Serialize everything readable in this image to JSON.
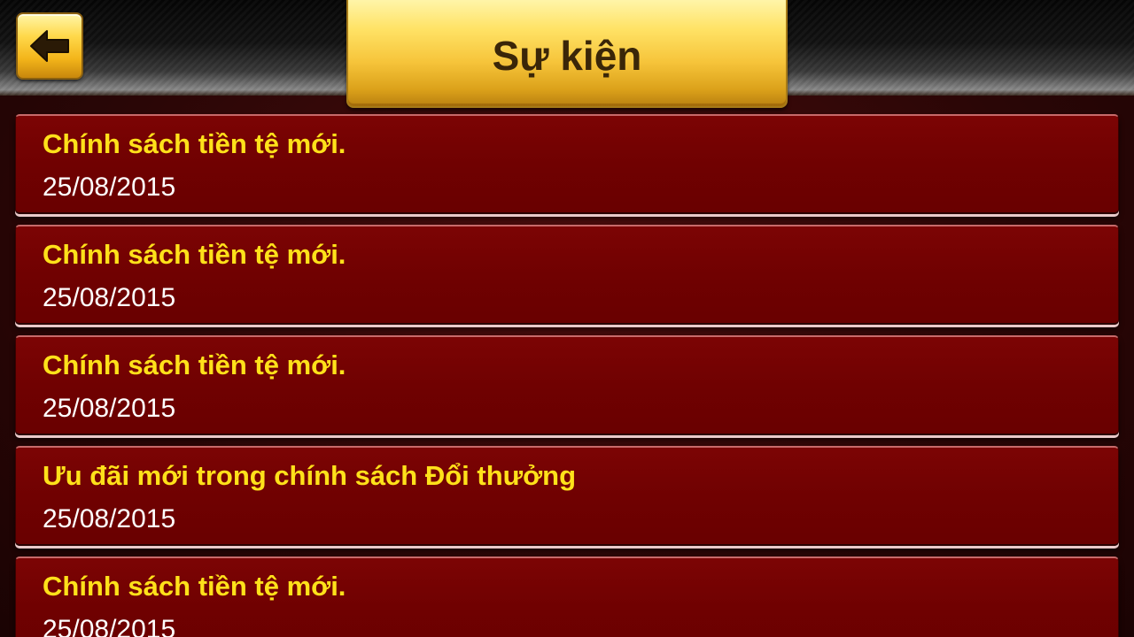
{
  "header": {
    "title": "Sự kiện",
    "back_icon": "back-arrow-icon"
  },
  "colors": {
    "accent_gold": "#ffd84a",
    "item_background": "#700101",
    "item_title": "#ffe11a",
    "item_date": "#ffffff",
    "title_text": "#3a2608"
  },
  "events": [
    {
      "title": "Chính sách tiền tệ mới.",
      "date": "25/08/2015"
    },
    {
      "title": "Chính sách tiền tệ mới.",
      "date": "25/08/2015"
    },
    {
      "title": "Chính sách tiền tệ mới.",
      "date": "25/08/2015"
    },
    {
      "title": "Ưu đãi mới trong chính sách Đổi thưởng",
      "date": "25/08/2015"
    },
    {
      "title": "Chính sách tiền tệ mới.",
      "date": "25/08/2015"
    }
  ]
}
